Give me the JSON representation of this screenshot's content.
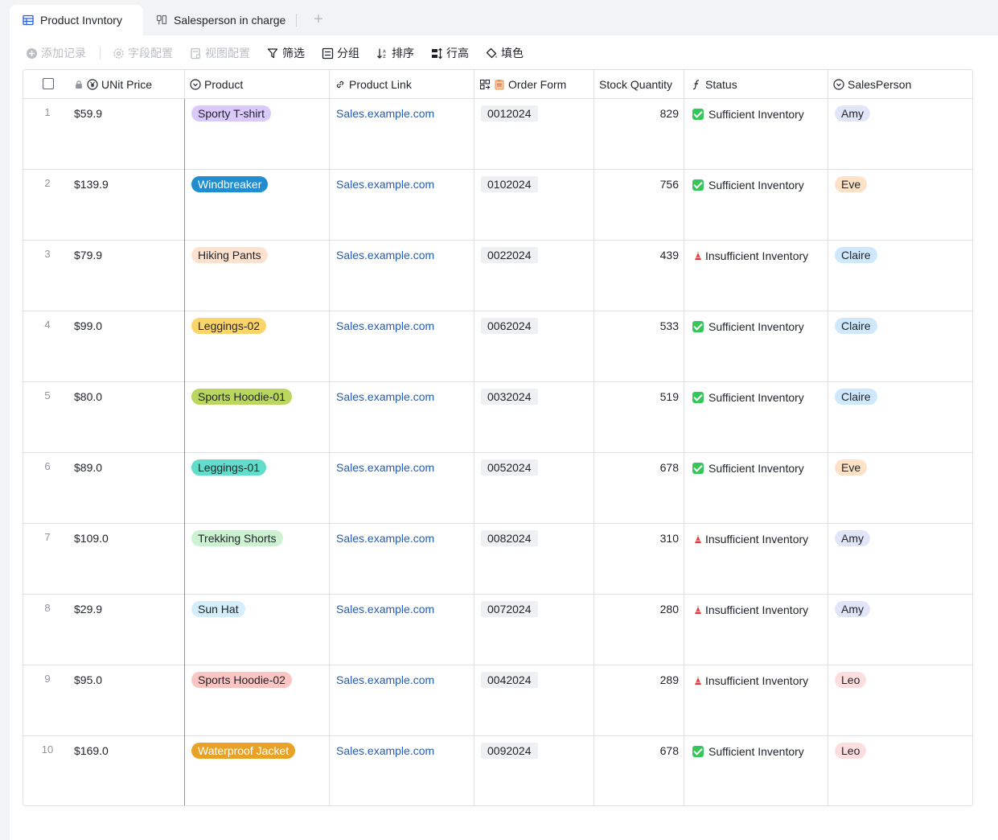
{
  "tabs": [
    {
      "label": "Product Invntory",
      "icon": "table-icon",
      "active": true
    },
    {
      "label": "Salesperson in charge",
      "icon": "kanban-icon",
      "active": false
    }
  ],
  "toolbar": {
    "add_record": "添加记录",
    "field_config": "字段配置",
    "view_config": "视图配置",
    "filter": "筛选",
    "group": "分组",
    "sort": "排序",
    "row_height": "行高",
    "fill_color": "填色"
  },
  "columns": {
    "price": "UNit Price",
    "product": "Product",
    "link": "Product Link",
    "order": "Order Form",
    "stock": "Stock Quantity",
    "status": "Status",
    "salesperson": "SalesPerson"
  },
  "rows": [
    {
      "num": "1",
      "price": "$59.9",
      "product": "Sporty T-shirt",
      "product_color": "#dcc9fb",
      "link": "Sales.example.com",
      "order": "0012024",
      "stock": "829",
      "status": "Sufficient Inventory",
      "ok": true,
      "sales": "Amy",
      "sales_color": "#e1e5f8"
    },
    {
      "num": "2",
      "price": "$139.9",
      "product": "Windbreaker",
      "product_color": "#1f8dcf",
      "product_text": "#ffffff",
      "link": "Sales.example.com",
      "order": "0102024",
      "stock": "756",
      "status": "Sufficient Inventory",
      "ok": true,
      "sales": "Eve",
      "sales_color": "#fde2c8"
    },
    {
      "num": "3",
      "price": "$79.9",
      "product": "Hiking Pants",
      "product_color": "#fde3cf",
      "link": "Sales.example.com",
      "order": "0022024",
      "stock": "439",
      "status": "Insufficient Inventory",
      "ok": false,
      "sales": "Claire",
      "sales_color": "#cfe8fb"
    },
    {
      "num": "4",
      "price": "$99.0",
      "product": "Leggings-02",
      "product_color": "#fbd46a",
      "link": "Sales.example.com",
      "order": "0062024",
      "stock": "533",
      "status": "Sufficient Inventory",
      "ok": true,
      "sales": "Claire",
      "sales_color": "#cfe8fb"
    },
    {
      "num": "5",
      "price": "$80.0",
      "product": "Sports Hoodie-01",
      "product_color": "#b9d65f",
      "link": "Sales.example.com",
      "order": "0032024",
      "stock": "519",
      "status": "Sufficient Inventory",
      "ok": true,
      "sales": "Claire",
      "sales_color": "#cfe8fb"
    },
    {
      "num": "6",
      "price": "$89.0",
      "product": "Leggings-01",
      "product_color": "#62dccb",
      "link": "Sales.example.com",
      "order": "0052024",
      "stock": "678",
      "status": "Sufficient Inventory",
      "ok": true,
      "sales": "Eve",
      "sales_color": "#fde2c8"
    },
    {
      "num": "7",
      "price": "$109.0",
      "product": "Trekking Shorts",
      "product_color": "#cdf2d2",
      "link": "Sales.example.com",
      "order": "0082024",
      "stock": "310",
      "status": "Insufficient Inventory",
      "ok": false,
      "sales": "Amy",
      "sales_color": "#e1e5f8"
    },
    {
      "num": "8",
      "price": "$29.9",
      "product": "Sun Hat",
      "product_color": "#d5eefb",
      "link": "Sales.example.com",
      "order": "0072024",
      "stock": "280",
      "status": "Insufficient Inventory",
      "ok": false,
      "sales": "Amy",
      "sales_color": "#e1e5f8"
    },
    {
      "num": "9",
      "price": "$95.0",
      "product": "Sports Hoodie-02",
      "product_color": "#fbc5c3",
      "link": "Sales.example.com",
      "order": "0042024",
      "stock": "289",
      "status": "Insufficient Inventory",
      "ok": false,
      "sales": "Leo",
      "sales_color": "#fcdede"
    },
    {
      "num": "10",
      "price": "$169.0",
      "product": "Waterproof Jacket",
      "product_color": "#e8a326",
      "product_text": "#ffffff",
      "link": "Sales.example.com",
      "order": "0092024",
      "stock": "678",
      "status": "Sufficient Inventory",
      "ok": true,
      "sales": "Leo",
      "sales_color": "#fcdede"
    }
  ]
}
